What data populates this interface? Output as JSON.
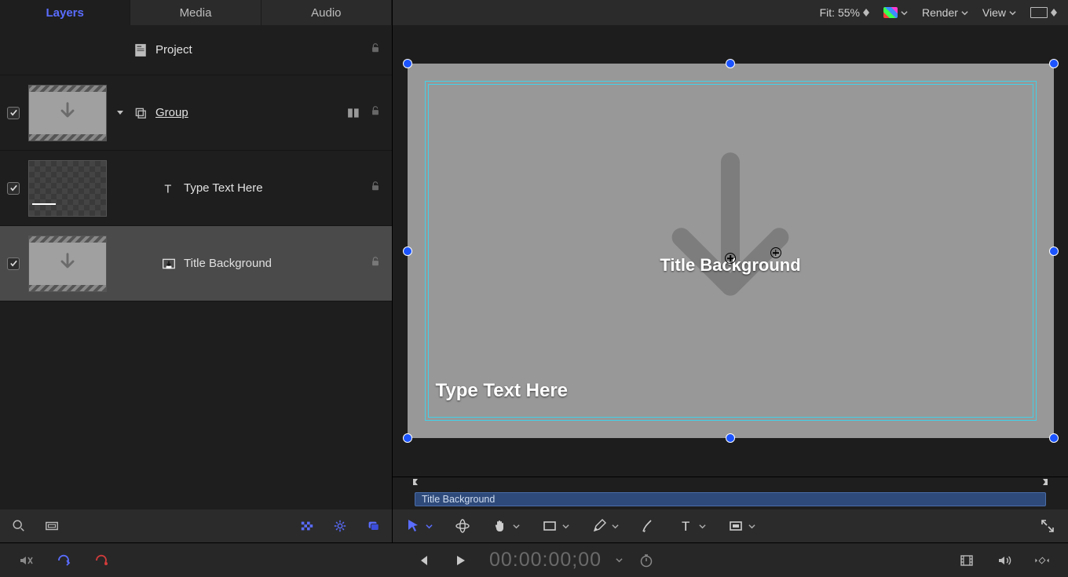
{
  "tabs": {
    "layers": "Layers",
    "media": "Media",
    "audio": "Audio"
  },
  "project": {
    "label": "Project"
  },
  "layers": {
    "group": {
      "label": "Group"
    },
    "text": {
      "label": "Type Text Here"
    },
    "titlebg": {
      "label": "Title Background"
    }
  },
  "canvas": {
    "fit_label": "Fit: 55%",
    "render_label": "Render",
    "view_label": "View",
    "text_layer": "Type Text Here",
    "titlebg_label": "Title Background"
  },
  "clip": {
    "name": "Title Background"
  },
  "transport": {
    "timecode": "00:00:00;00"
  }
}
